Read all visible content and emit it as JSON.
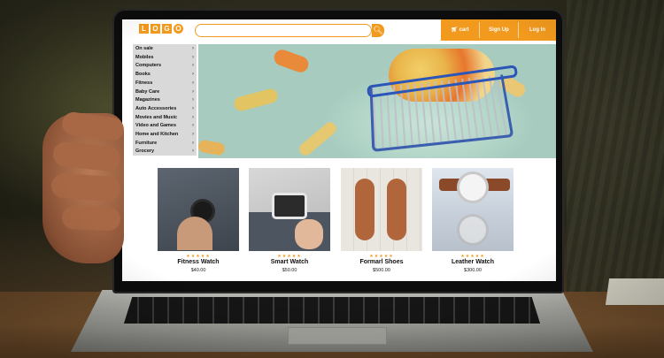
{
  "store": {
    "logo_letters": [
      "L",
      "O",
      "G",
      "O"
    ],
    "search": {
      "placeholder": "",
      "icon": "search-icon"
    },
    "nav": {
      "cart_label": "cart",
      "signup_label": "Sign Up",
      "login_label": "Log In"
    }
  },
  "sidebar": {
    "items": [
      {
        "label": "On sale"
      },
      {
        "label": "Mobiles"
      },
      {
        "label": "Computers"
      },
      {
        "label": "Books"
      },
      {
        "label": "Fitness"
      },
      {
        "label": "Baby Care"
      },
      {
        "label": "Magazines"
      },
      {
        "label": "Auto Accessories"
      },
      {
        "label": "Movies and Music"
      },
      {
        "label": "Video and Games"
      },
      {
        "label": "Home and Kitchen"
      },
      {
        "label": "Furniture"
      },
      {
        "label": "Grocery"
      }
    ]
  },
  "products": [
    {
      "name": "Fitness Watch",
      "price": "$40.00",
      "stars": "★★★★★"
    },
    {
      "name": "Smart Watch",
      "price": "$50.00",
      "stars": "★★★★★"
    },
    {
      "name": "Formarl Shoes",
      "price": "$500.00",
      "stars": "★★★★★"
    },
    {
      "name": "Leather Watch",
      "price": "$300.00",
      "stars": "★★★★★"
    }
  ],
  "colors": {
    "accent": "#f29a1e",
    "sidebar_bg": "#d9d9d9",
    "banner_bg": "#b7d8cb"
  }
}
